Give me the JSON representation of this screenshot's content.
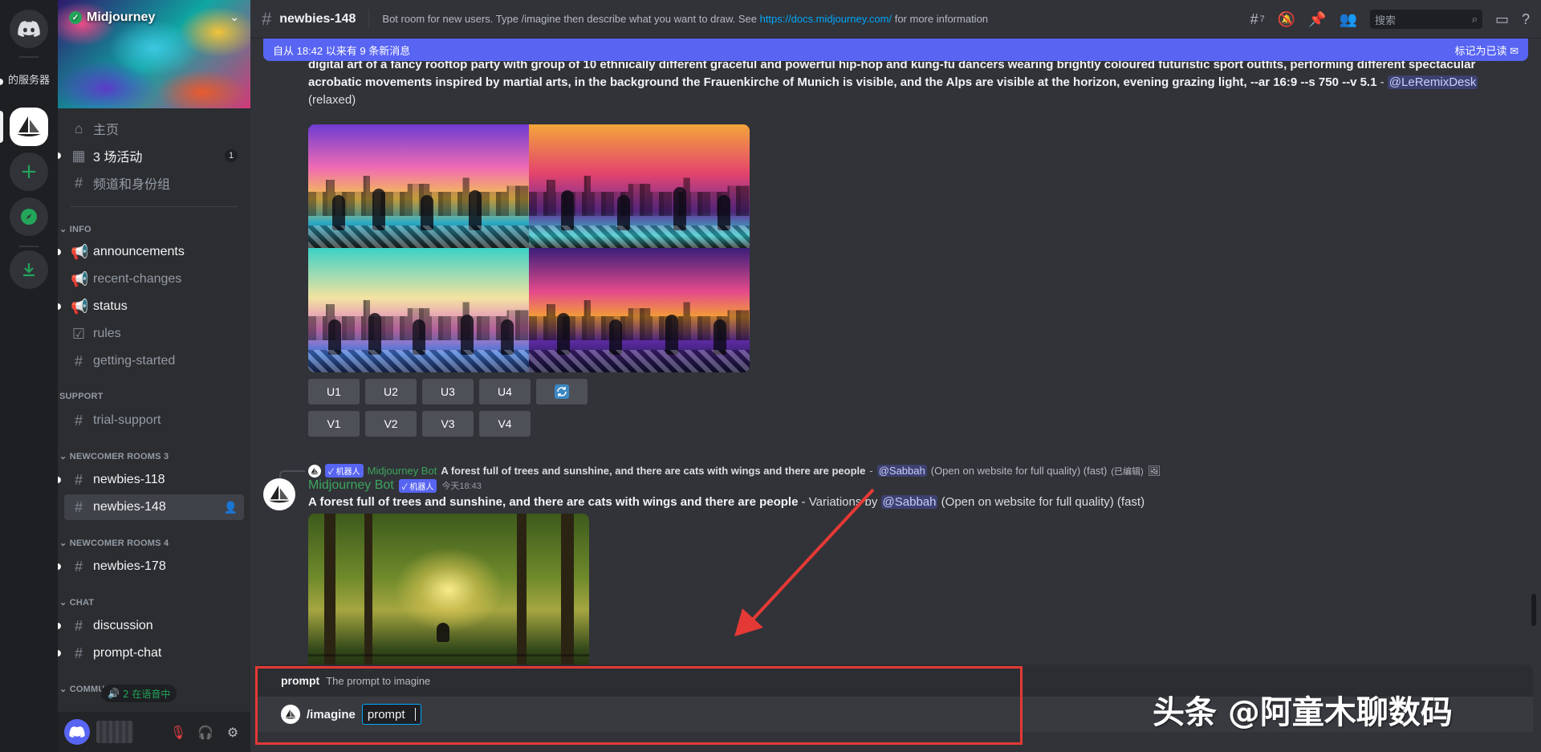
{
  "rail": {
    "server_short": "的服务器"
  },
  "server": {
    "name": "Midjourney"
  },
  "sidebar": {
    "top": [
      {
        "label": "主页"
      },
      {
        "label": "3 场活动",
        "badge": "1"
      },
      {
        "label": "频道和身份组"
      }
    ],
    "categories": {
      "info": "INFO",
      "support": "SUPPORT",
      "newcomer3": "NEWCOMER ROOMS 3",
      "newcomer4": "NEWCOMER ROOMS 4",
      "chat": "CHAT",
      "community": "COMMUNITY"
    },
    "channels": {
      "announcements": "announcements",
      "recent_changes": "recent-changes",
      "status": "status",
      "rules": "rules",
      "getting_started": "getting-started",
      "trial_support": "trial-support",
      "newbies_118": "newbies-118",
      "newbies_148": "newbies-148",
      "newbies_178": "newbies-178",
      "discussion": "discussion",
      "prompt_chat": "prompt-chat"
    },
    "voice_pill": "2 在语音中"
  },
  "header": {
    "channel": "newbies-148",
    "topic_before": "Bot room for new users. Type /imagine then describe what you want to draw. See ",
    "topic_link": "https://docs.midjourney.com/",
    "topic_after": " for more information",
    "threads_count": "7",
    "search_placeholder": "搜索"
  },
  "newbar": {
    "left": "自从 18:42 以来有 9 条新消息",
    "right": "标记为已读"
  },
  "message1": {
    "prompt": "digital art of a fancy rooftop party with group of 10 ethnically different graceful and powerful hip-hop and kung-fu dancers wearing brightly coloured futuristic sport outfits, performing different spectacular acrobatic movements inspired by martial arts, in the background the Frauenkirche of Munich is visible, and the Alps are visible at the horizon, evening grazing light, --ar 16:9 --s 750 --v 5.1",
    "dash": " - ",
    "mention": "@LeRemixDesk",
    "mode": "(relaxed)",
    "buttons_u": [
      "U1",
      "U2",
      "U3",
      "U4"
    ],
    "buttons_v": [
      "V1",
      "V2",
      "V3",
      "V4"
    ],
    "reroll_icon": "refresh-icon"
  },
  "message2": {
    "reply_badge": "✓ 机器人",
    "reply_author": "Midjourney Bot",
    "reply_prompt": "A forest full of trees and sunshine, and there are cats with wings and there are people",
    "reply_dash": " - ",
    "reply_mention": "@Sabbah",
    "reply_suffix": "(Open on website for full quality) (fast)",
    "reply_edited": "(已编辑)",
    "author": "Midjourney Bot",
    "badge": "✓ 机器人",
    "time": "今天18:43",
    "prompt": "A forest full of trees and sunshine, and there are cats with wings and there are people",
    "variations": " - Variations by ",
    "mention": "@Sabbah",
    "suffix": " (Open on website for full quality) (fast)"
  },
  "composer": {
    "hint_key": "prompt",
    "hint_desc": "The prompt to imagine",
    "command": "/imagine",
    "param": "prompt"
  },
  "watermark": "头条 @阿童木聊数码",
  "colors": {
    "accent": "#5865f2",
    "link": "#00a8fc",
    "bot_green": "#3ba55c",
    "annotation_red": "#e53935"
  }
}
